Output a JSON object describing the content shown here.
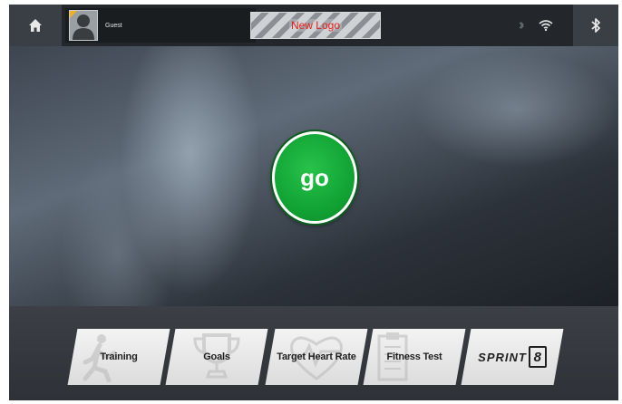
{
  "topbar": {
    "home_icon": "home-icon",
    "user_name": "Guest",
    "avatar_icon": "user-silhouette-icon",
    "logo_text": "New Logo",
    "status_icons": [
      "bluetooth-small-icon",
      "wifi-icon"
    ],
    "bluetooth_button_icon": "bluetooth-icon"
  },
  "main": {
    "go_label": "go"
  },
  "tiles": [
    {
      "label": "Training",
      "icon": "runner-icon"
    },
    {
      "label": "Goals",
      "icon": "trophy-icon"
    },
    {
      "label": "Target Heart Rate",
      "icon": "heart-icon"
    },
    {
      "label": "Fitness Test",
      "icon": "clipboard-icon"
    },
    {
      "label": "SPRINT",
      "badge": "8",
      "icon": "sprint8-logo"
    }
  ],
  "colors": {
    "go_green": "#12a335",
    "logo_text": "#e0201a",
    "avatar_corner": "#f2b01e"
  }
}
